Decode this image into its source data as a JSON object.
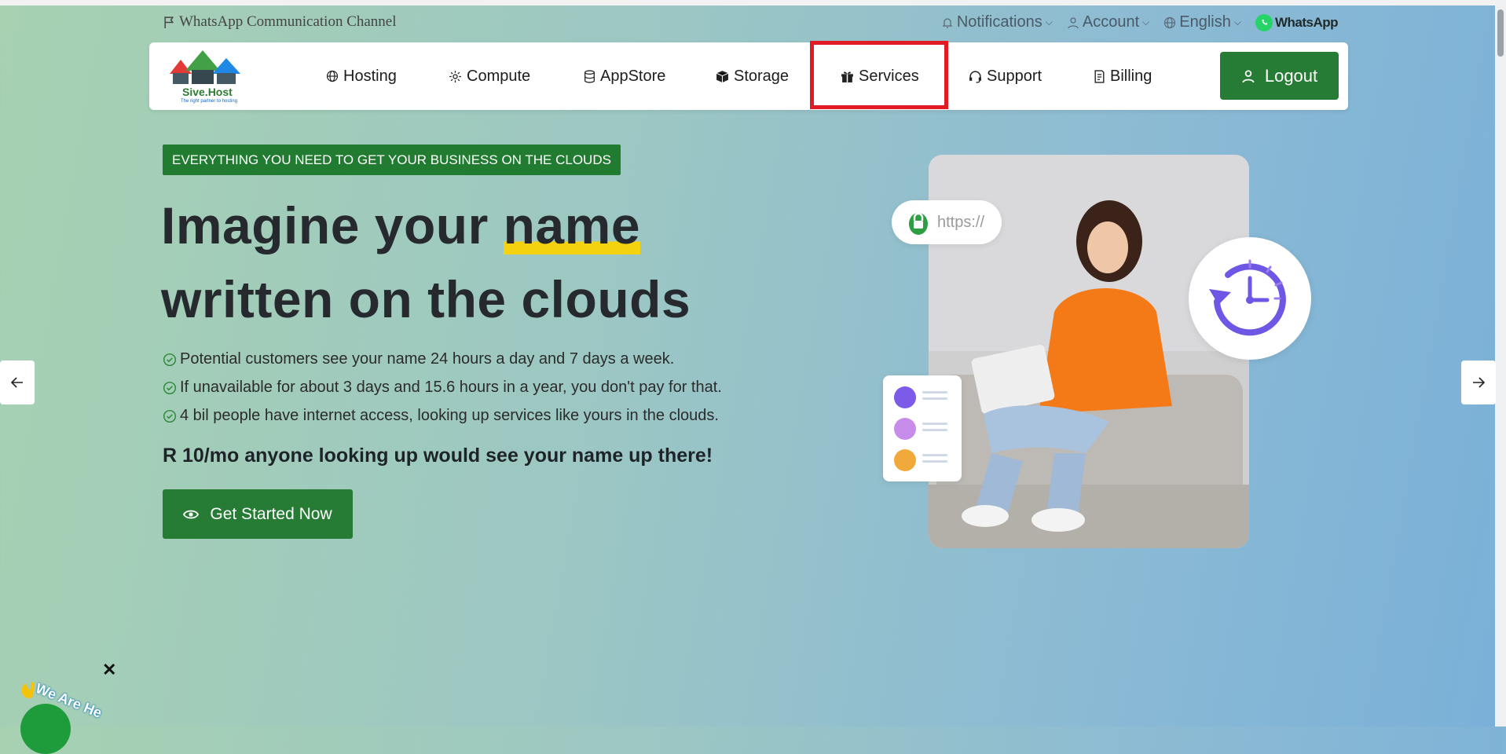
{
  "topbar": {
    "channel_label": "WhatsApp Communication Channel",
    "notifications_label": "Notifications",
    "account_label": "Account",
    "language_label": "English",
    "whatsapp_label": "WhatsApp"
  },
  "nav": {
    "logo_text": "Sive.Host",
    "logo_tagline": "The right partner to hosting",
    "items": [
      {
        "label": "Hosting",
        "icon": "globe-icon"
      },
      {
        "label": "Compute",
        "icon": "gear-icon"
      },
      {
        "label": "AppStore",
        "icon": "database-icon"
      },
      {
        "label": "Storage",
        "icon": "box-icon"
      },
      {
        "label": "Services",
        "icon": "gift-icon"
      },
      {
        "label": "Support",
        "icon": "headset-icon"
      },
      {
        "label": "Billing",
        "icon": "invoice-icon"
      }
    ],
    "logout_label": "Logout",
    "highlight_color": "#e01b24"
  },
  "hero": {
    "badge": "EVERYTHING YOU NEED TO GET YOUR BUSINESS ON THE CLOUDS",
    "title_part1": "Imagine your ",
    "title_highlight": "name",
    "title_line2": "written on the clouds",
    "bullets": [
      "Potential customers see your name 24 hours a day and 7 days a week.",
      "If unavailable for about 3 days and 15.6 hours in a year, you don't pay for that.",
      "4 bil people have internet access, looking up services like yours in the clouds."
    ],
    "price_line": "R 10/mo anyone looking up would see your name up there!",
    "cta_label": "Get Started Now",
    "https_label": "https://"
  },
  "help_widget": {
    "label": "We Are He"
  },
  "colors": {
    "brand_green": "#267c34",
    "badge_green": "#217b31",
    "highlight_yellow": "#f5d20f"
  }
}
